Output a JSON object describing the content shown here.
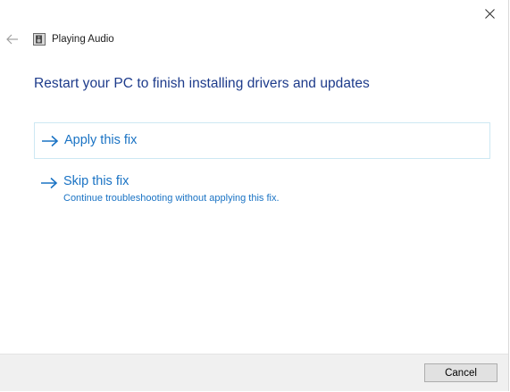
{
  "window": {
    "title": "Playing Audio"
  },
  "main": {
    "heading": "Restart your PC to finish installing drivers and updates",
    "options": [
      {
        "label": "Apply this fix",
        "description": ""
      },
      {
        "label": "Skip this fix",
        "description": "Continue troubleshooting without applying this fix."
      }
    ]
  },
  "footer": {
    "cancel_label": "Cancel"
  },
  "icons": {
    "back": "back-arrow-icon",
    "close": "close-icon",
    "app": "speaker-icon",
    "option_arrow": "arrow-right-icon"
  },
  "colors": {
    "heading": "#1d3b8b",
    "link": "#1a73c4",
    "option_border": "#cde8f3",
    "footer_bg": "#f0f0f0"
  }
}
